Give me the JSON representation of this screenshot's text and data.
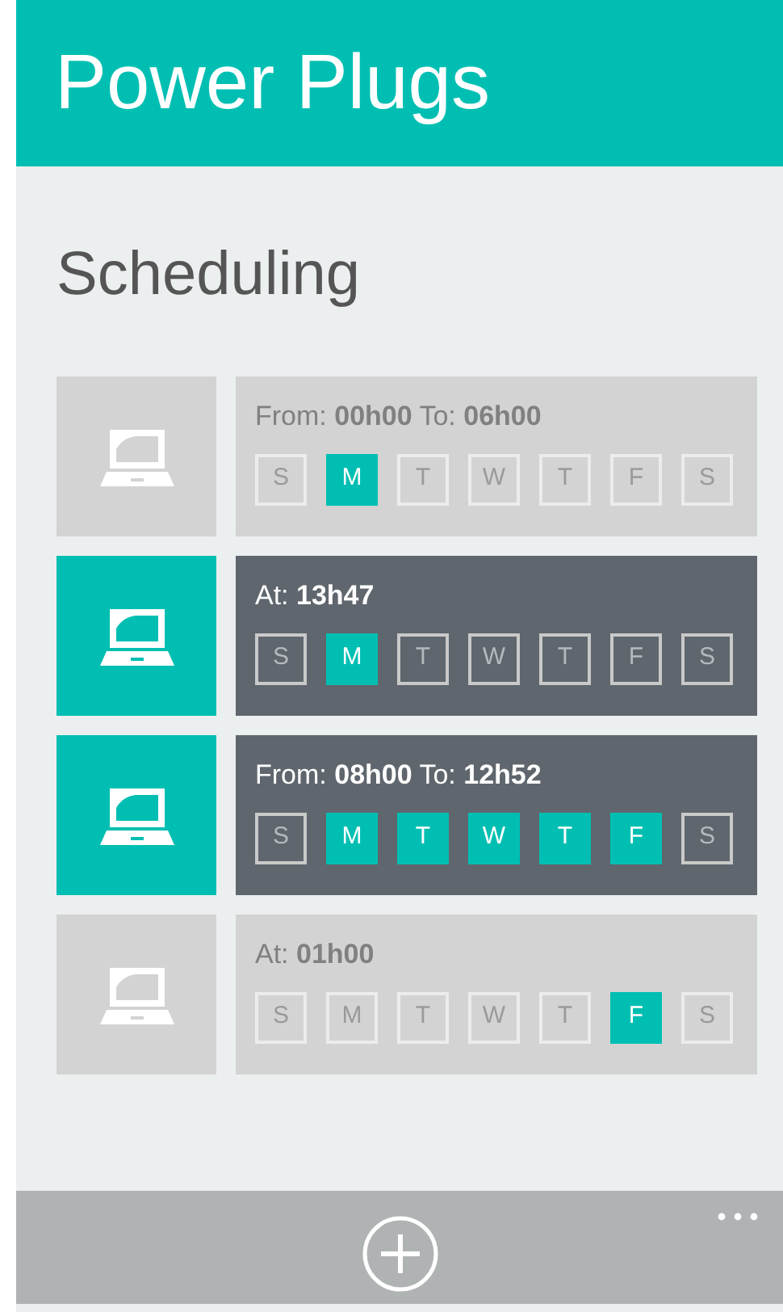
{
  "header": {
    "title": "Power Plugs"
  },
  "page": {
    "heading": "Scheduling"
  },
  "schedules": [
    {
      "on": false,
      "time": "From: **00h00** To: **06h00**",
      "days": [
        {
          "label": "S",
          "selected": false
        },
        {
          "label": "M",
          "selected": true
        },
        {
          "label": "T",
          "selected": false
        },
        {
          "label": "W",
          "selected": false
        },
        {
          "label": "T",
          "selected": false
        },
        {
          "label": "F",
          "selected": false
        },
        {
          "label": "S",
          "selected": false
        }
      ]
    },
    {
      "on": true,
      "time": "At: **13h47**",
      "days": [
        {
          "label": "S",
          "selected": false
        },
        {
          "label": "M",
          "selected": true
        },
        {
          "label": "T",
          "selected": false
        },
        {
          "label": "W",
          "selected": false
        },
        {
          "label": "T",
          "selected": false
        },
        {
          "label": "F",
          "selected": false
        },
        {
          "label": "S",
          "selected": false
        }
      ]
    },
    {
      "on": true,
      "time": "From: **08h00** To: **12h52**",
      "days": [
        {
          "label": "S",
          "selected": false
        },
        {
          "label": "M",
          "selected": true
        },
        {
          "label": "T",
          "selected": true
        },
        {
          "label": "W",
          "selected": true
        },
        {
          "label": "T",
          "selected": true
        },
        {
          "label": "F",
          "selected": true
        },
        {
          "label": "S",
          "selected": false
        }
      ]
    },
    {
      "on": false,
      "time": "At: **01h00**",
      "days": [
        {
          "label": "S",
          "selected": false
        },
        {
          "label": "M",
          "selected": false
        },
        {
          "label": "T",
          "selected": false
        },
        {
          "label": "W",
          "selected": false
        },
        {
          "label": "T",
          "selected": false
        },
        {
          "label": "F",
          "selected": true
        },
        {
          "label": "S",
          "selected": false
        }
      ]
    }
  ]
}
